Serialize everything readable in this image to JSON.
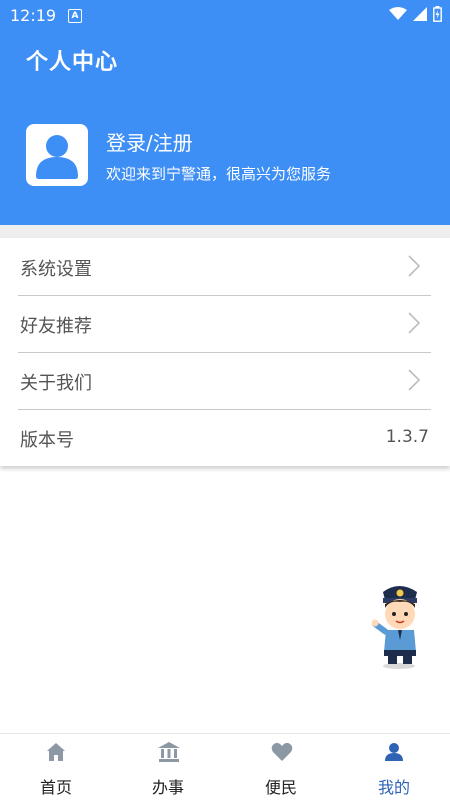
{
  "status_bar": {
    "time": "12:19",
    "notification_glyph": "A"
  },
  "header": {
    "title": "个人中心",
    "login_label": "登录/注册",
    "welcome_text": "欢迎来到宁警通，很高兴为您服务"
  },
  "menu": {
    "items": [
      {
        "label": "系统设置",
        "icon": "chevron-right-icon"
      },
      {
        "label": "好友推荐",
        "icon": "chevron-right-icon"
      },
      {
        "label": "关于我们",
        "icon": "chevron-right-icon"
      },
      {
        "label": "版本号",
        "value": "1.3.7"
      }
    ]
  },
  "tabbar": {
    "tabs": [
      {
        "label": "首页",
        "icon": "home-icon"
      },
      {
        "label": "办事",
        "icon": "bank-building-icon"
      },
      {
        "label": "便民",
        "icon": "heart-icon"
      },
      {
        "label": "我的",
        "icon": "person-icon",
        "active": true
      }
    ]
  },
  "colors": {
    "primary": "#3d8ef5",
    "tab_active": "#2e63b5",
    "tab_inactive": "#8d98a5",
    "separator": "#eeeeee"
  }
}
